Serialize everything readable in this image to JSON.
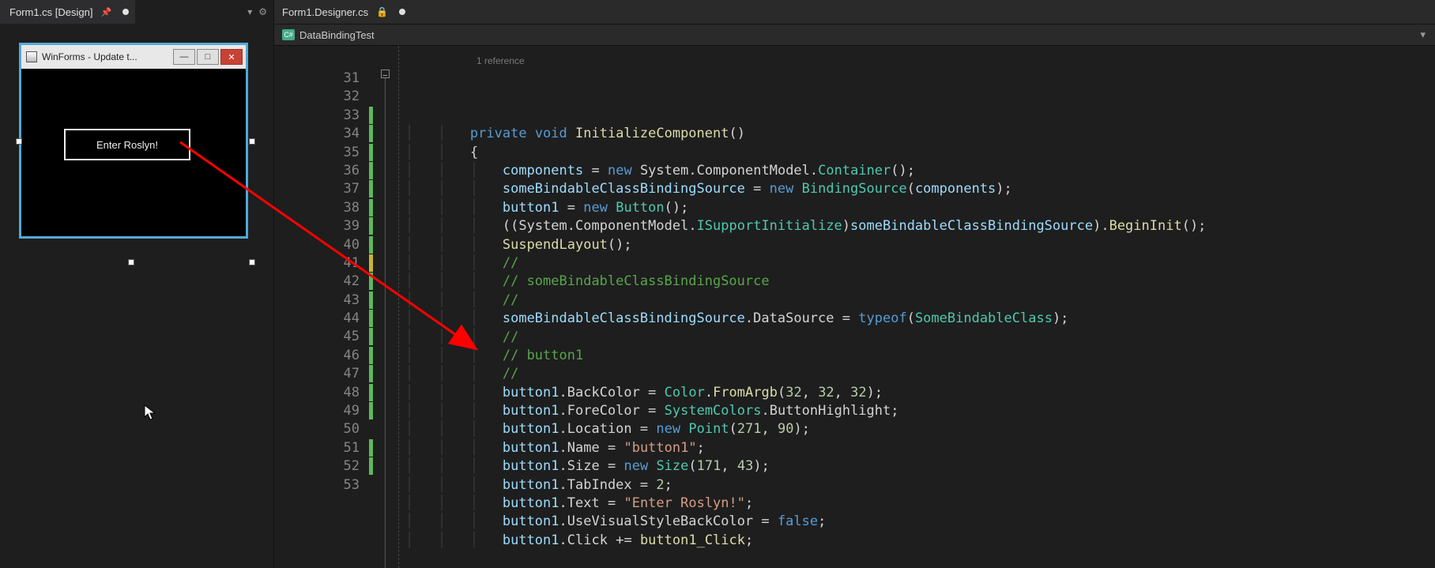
{
  "tabs": {
    "designer": {
      "label": "Form1.cs [Design]"
    },
    "code": {
      "label": "Form1.Designer.cs"
    }
  },
  "nav": {
    "namespace": "DataBindingTest"
  },
  "winform": {
    "title": "WinForms - Update t...",
    "button_text": "Enter Roslyn!"
  },
  "codelens": {
    "references": "1 reference"
  },
  "lines": [
    {
      "num": "31",
      "mark": "",
      "tokens": [
        [
          "indent",
          "        "
        ],
        [
          "kw",
          "private"
        ],
        [
          "punc",
          " "
        ],
        [
          "kw",
          "void"
        ],
        [
          "punc",
          " "
        ],
        [
          "method",
          "InitializeComponent"
        ],
        [
          "punc",
          "()"
        ]
      ]
    },
    {
      "num": "32",
      "mark": "",
      "tokens": [
        [
          "indent",
          "        "
        ],
        [
          "punc",
          "{"
        ]
      ]
    },
    {
      "num": "33",
      "mark": "green",
      "tokens": [
        [
          "indent",
          "            "
        ],
        [
          "field",
          "components"
        ],
        [
          "punc",
          " "
        ],
        [
          "op",
          "="
        ],
        [
          "punc",
          " "
        ],
        [
          "kw",
          "new"
        ],
        [
          "punc",
          " "
        ],
        [
          "ident",
          "System"
        ],
        [
          "punc",
          "."
        ],
        [
          "ident",
          "ComponentModel"
        ],
        [
          "punc",
          "."
        ],
        [
          "type",
          "Container"
        ],
        [
          "punc",
          "();"
        ]
      ]
    },
    {
      "num": "34",
      "mark": "green",
      "tokens": [
        [
          "indent",
          "            "
        ],
        [
          "field",
          "someBindableClassBindingSource"
        ],
        [
          "punc",
          " "
        ],
        [
          "op",
          "="
        ],
        [
          "punc",
          " "
        ],
        [
          "kw",
          "new"
        ],
        [
          "punc",
          " "
        ],
        [
          "type",
          "BindingSource"
        ],
        [
          "punc",
          "("
        ],
        [
          "field",
          "components"
        ],
        [
          "punc",
          ");"
        ]
      ]
    },
    {
      "num": "35",
      "mark": "green",
      "tokens": [
        [
          "indent",
          "            "
        ],
        [
          "field",
          "button1"
        ],
        [
          "punc",
          " "
        ],
        [
          "op",
          "="
        ],
        [
          "punc",
          " "
        ],
        [
          "kw",
          "new"
        ],
        [
          "punc",
          " "
        ],
        [
          "type",
          "Button"
        ],
        [
          "punc",
          "();"
        ]
      ]
    },
    {
      "num": "36",
      "mark": "green",
      "tokens": [
        [
          "indent",
          "            "
        ],
        [
          "punc",
          "(("
        ],
        [
          "ident",
          "System"
        ],
        [
          "punc",
          "."
        ],
        [
          "ident",
          "ComponentModel"
        ],
        [
          "punc",
          "."
        ],
        [
          "type",
          "ISupportInitialize"
        ],
        [
          "punc",
          ")"
        ],
        [
          "field",
          "someBindableClassBindingSource"
        ],
        [
          "punc",
          ")."
        ],
        [
          "method",
          "BeginInit"
        ],
        [
          "punc",
          "();"
        ]
      ]
    },
    {
      "num": "37",
      "mark": "green",
      "tokens": [
        [
          "indent",
          "            "
        ],
        [
          "method",
          "SuspendLayout"
        ],
        [
          "punc",
          "();"
        ]
      ]
    },
    {
      "num": "38",
      "mark": "green",
      "tokens": [
        [
          "indent",
          "            "
        ],
        [
          "comm",
          "//"
        ]
      ]
    },
    {
      "num": "39",
      "mark": "green",
      "tokens": [
        [
          "indent",
          "            "
        ],
        [
          "comm",
          "// someBindableClassBindingSource"
        ]
      ]
    },
    {
      "num": "40",
      "mark": "green",
      "tokens": [
        [
          "indent",
          "            "
        ],
        [
          "comm",
          "//"
        ]
      ]
    },
    {
      "num": "41",
      "mark": "yellow",
      "tokens": [
        [
          "indent",
          "            "
        ],
        [
          "field",
          "someBindableClassBindingSource"
        ],
        [
          "punc",
          "."
        ],
        [
          "prop",
          "DataSource"
        ],
        [
          "punc",
          " "
        ],
        [
          "op",
          "="
        ],
        [
          "punc",
          " "
        ],
        [
          "kw",
          "typeof"
        ],
        [
          "punc",
          "("
        ],
        [
          "type",
          "SomeBindableClass"
        ],
        [
          "punc",
          ");"
        ]
      ]
    },
    {
      "num": "42",
      "mark": "green",
      "tokens": [
        [
          "indent",
          "            "
        ],
        [
          "comm",
          "//"
        ]
      ]
    },
    {
      "num": "43",
      "mark": "green",
      "tokens": [
        [
          "indent",
          "            "
        ],
        [
          "comm",
          "// button1"
        ]
      ]
    },
    {
      "num": "44",
      "mark": "green",
      "tokens": [
        [
          "indent",
          "            "
        ],
        [
          "comm",
          "//"
        ]
      ]
    },
    {
      "num": "45",
      "mark": "green",
      "tokens": [
        [
          "indent",
          "            "
        ],
        [
          "field",
          "button1"
        ],
        [
          "punc",
          "."
        ],
        [
          "prop",
          "BackColor"
        ],
        [
          "punc",
          " "
        ],
        [
          "op",
          "="
        ],
        [
          "punc",
          " "
        ],
        [
          "type",
          "Color"
        ],
        [
          "punc",
          "."
        ],
        [
          "method",
          "FromArgb"
        ],
        [
          "punc",
          "("
        ],
        [
          "num",
          "32"
        ],
        [
          "punc",
          ", "
        ],
        [
          "num",
          "32"
        ],
        [
          "punc",
          ", "
        ],
        [
          "num",
          "32"
        ],
        [
          "punc",
          ");"
        ]
      ]
    },
    {
      "num": "46",
      "mark": "green",
      "tokens": [
        [
          "indent",
          "            "
        ],
        [
          "field",
          "button1"
        ],
        [
          "punc",
          "."
        ],
        [
          "prop",
          "ForeColor"
        ],
        [
          "punc",
          " "
        ],
        [
          "op",
          "="
        ],
        [
          "punc",
          " "
        ],
        [
          "type",
          "SystemColors"
        ],
        [
          "punc",
          "."
        ],
        [
          "prop",
          "ButtonHighlight"
        ],
        [
          "punc",
          ";"
        ]
      ]
    },
    {
      "num": "47",
      "mark": "green",
      "tokens": [
        [
          "indent",
          "            "
        ],
        [
          "field",
          "button1"
        ],
        [
          "punc",
          "."
        ],
        [
          "prop",
          "Location"
        ],
        [
          "punc",
          " "
        ],
        [
          "op",
          "="
        ],
        [
          "punc",
          " "
        ],
        [
          "kw",
          "new"
        ],
        [
          "punc",
          " "
        ],
        [
          "type",
          "Point"
        ],
        [
          "punc",
          "("
        ],
        [
          "num",
          "271"
        ],
        [
          "punc",
          ", "
        ],
        [
          "num",
          "90"
        ],
        [
          "punc",
          ");"
        ]
      ]
    },
    {
      "num": "48",
      "mark": "green",
      "tokens": [
        [
          "indent",
          "            "
        ],
        [
          "field",
          "button1"
        ],
        [
          "punc",
          "."
        ],
        [
          "prop",
          "Name"
        ],
        [
          "punc",
          " "
        ],
        [
          "op",
          "="
        ],
        [
          "punc",
          " "
        ],
        [
          "str",
          "\"button1\""
        ],
        [
          "punc",
          ";"
        ]
      ]
    },
    {
      "num": "49",
      "mark": "green",
      "tokens": [
        [
          "indent",
          "            "
        ],
        [
          "field",
          "button1"
        ],
        [
          "punc",
          "."
        ],
        [
          "prop",
          "Size"
        ],
        [
          "punc",
          " "
        ],
        [
          "op",
          "="
        ],
        [
          "punc",
          " "
        ],
        [
          "kw",
          "new"
        ],
        [
          "punc",
          " "
        ],
        [
          "type",
          "Size"
        ],
        [
          "punc",
          "("
        ],
        [
          "num",
          "171"
        ],
        [
          "punc",
          ", "
        ],
        [
          "num",
          "43"
        ],
        [
          "punc",
          ");"
        ]
      ]
    },
    {
      "num": "50",
      "mark": "",
      "tokens": [
        [
          "indent",
          "            "
        ],
        [
          "field",
          "button1"
        ],
        [
          "punc",
          "."
        ],
        [
          "prop",
          "TabIndex"
        ],
        [
          "punc",
          " "
        ],
        [
          "op",
          "="
        ],
        [
          "punc",
          " "
        ],
        [
          "num",
          "2"
        ],
        [
          "punc",
          ";"
        ]
      ]
    },
    {
      "num": "51",
      "mark": "green",
      "tokens": [
        [
          "indent",
          "            "
        ],
        [
          "field",
          "button1"
        ],
        [
          "punc",
          "."
        ],
        [
          "prop",
          "Text"
        ],
        [
          "punc",
          " "
        ],
        [
          "op",
          "="
        ],
        [
          "punc",
          " "
        ],
        [
          "str",
          "\"Enter Roslyn!\""
        ],
        [
          "punc",
          ";"
        ]
      ]
    },
    {
      "num": "52",
      "mark": "green",
      "tokens": [
        [
          "indent",
          "            "
        ],
        [
          "field",
          "button1"
        ],
        [
          "punc",
          "."
        ],
        [
          "prop",
          "UseVisualStyleBackColor"
        ],
        [
          "punc",
          " "
        ],
        [
          "op",
          "="
        ],
        [
          "punc",
          " "
        ],
        [
          "kw",
          "false"
        ],
        [
          "punc",
          ";"
        ]
      ]
    },
    {
      "num": "53",
      "mark": "",
      "tokens": [
        [
          "indent",
          "            "
        ],
        [
          "field",
          "button1"
        ],
        [
          "punc",
          "."
        ],
        [
          "prop",
          "Click"
        ],
        [
          "punc",
          " "
        ],
        [
          "op",
          "+="
        ],
        [
          "punc",
          " "
        ],
        [
          "method",
          "button1_Click"
        ],
        [
          "punc",
          ";"
        ]
      ]
    }
  ]
}
